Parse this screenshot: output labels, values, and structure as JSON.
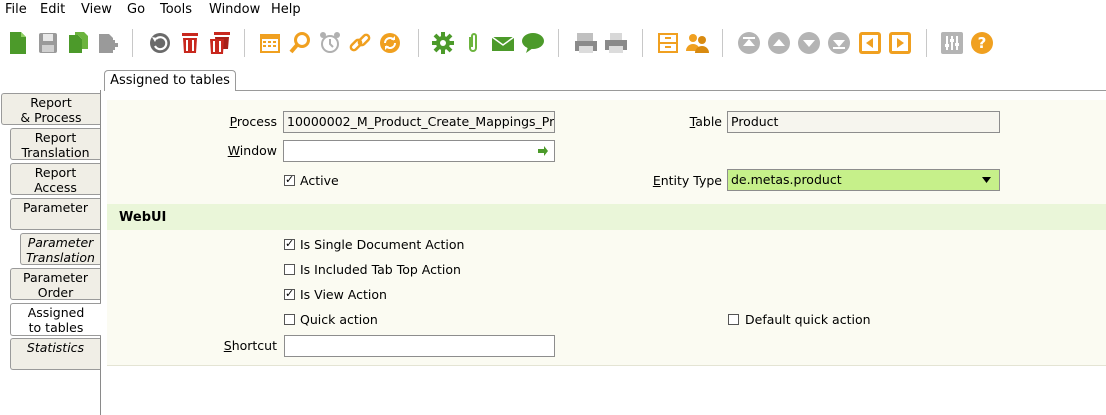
{
  "menu": [
    "File",
    "Edit",
    "View",
    "Go",
    "Tools",
    "Window",
    "Help"
  ],
  "toolbar": {
    "icons": [
      "new-icon",
      "save-icon",
      "copy-record-icon",
      "copy-details-icon",
      "undo-icon",
      "delete-icon",
      "delete-selection-icon",
      "calendar-icon",
      "find-icon",
      "reminder-icon",
      "zoom-across-icon",
      "refresh-icon",
      "gear-icon",
      "attachment-icon",
      "mail-icon",
      "chat-icon",
      "report-icon",
      "print-icon",
      "archive-icon",
      "requests-icon",
      "first-record-icon",
      "previous-record-icon",
      "next-record-icon",
      "last-record-icon",
      "parent-icon",
      "detail-icon",
      "settings-icon",
      "help-icon"
    ]
  },
  "top_tab": {
    "label": "Assigned to tables"
  },
  "side_tabs": [
    {
      "line1": "Report",
      "line2": "& Process"
    },
    {
      "line1": "Report",
      "line2": "Translation"
    },
    {
      "line1": "Report",
      "line2": "Access"
    },
    {
      "line1": "Parameter",
      "line2": ""
    },
    {
      "line1": "Parameter",
      "line2": "Translation"
    },
    {
      "line1": "Parameter",
      "line2": "Order"
    },
    {
      "line1": "Assigned",
      "line2": "to tables"
    },
    {
      "line1": "Statistics",
      "line2": ""
    }
  ],
  "form": {
    "process_label_u": "P",
    "process_label_rest": "rocess",
    "process_value": "10000002_M_Product_Create_Mappings_Pr",
    "window_label_u": "W",
    "window_label_rest": "indow",
    "window_value": "",
    "table_label_u": "T",
    "table_label_rest": "able",
    "table_value": "Product",
    "active_label": "Active",
    "active_checked": true,
    "entity_label_u": "E",
    "entity_label_rest": "ntity Type",
    "entity_value": "de.metas.product"
  },
  "section": {
    "title": "WebUI"
  },
  "webui": {
    "single_doc_label": "Is Single Document Action",
    "single_doc_checked": true,
    "included_tab_label": "Is Included Tab Top Action",
    "included_tab_checked": false,
    "view_action_label": "Is View Action",
    "view_action_checked": true,
    "quick_action_label": "Quick action",
    "quick_action_checked": false,
    "default_quick_label": "Default quick action",
    "default_quick_checked": false,
    "shortcut_label_u": "S",
    "shortcut_label_rest": "hortcut",
    "shortcut_value": ""
  },
  "colors": {
    "accent_green": "#c6f08a",
    "section_bg": "#eaf6d9",
    "icon_orange": "#f0a020",
    "icon_red": "#c8281e",
    "icon_green": "#4c9a2a"
  }
}
